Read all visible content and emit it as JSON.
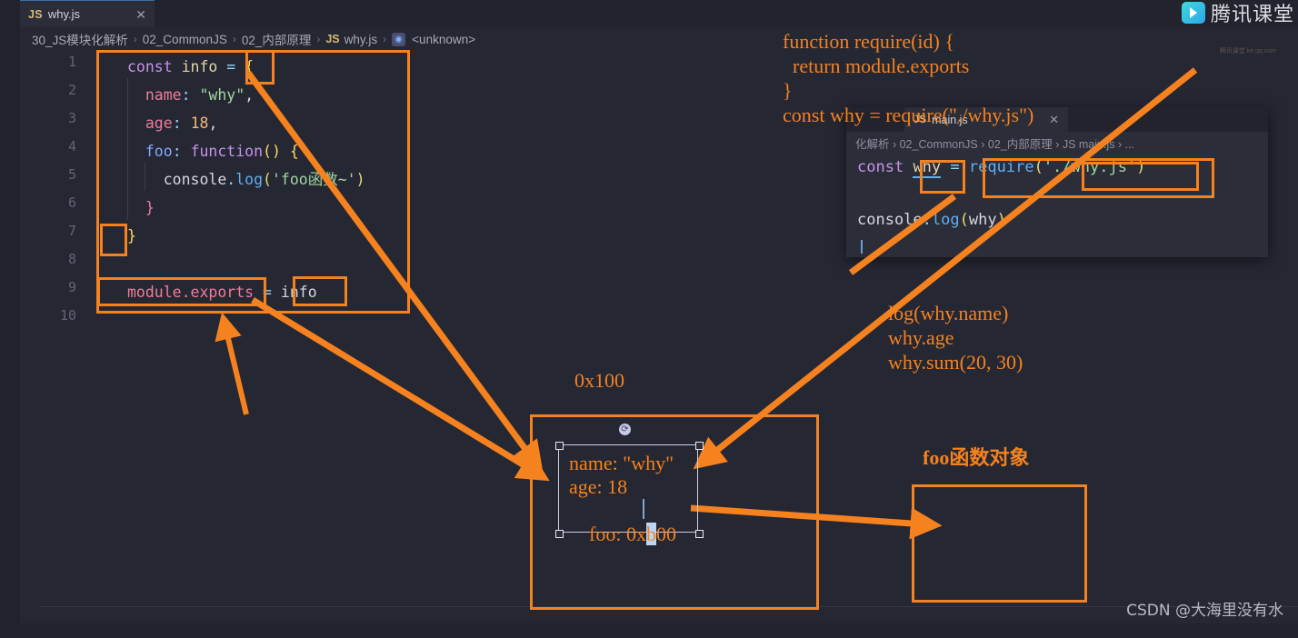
{
  "window": {
    "tab": {
      "badge": "JS",
      "title": "why.js",
      "close": "✕"
    },
    "breadcrumb": {
      "items": [
        "30_JS模块化解析",
        "02_CommonJS",
        "02_内部原理",
        "why.js",
        "<unknown>"
      ],
      "js_badge": "JS",
      "symbol_icon": "◉",
      "separator": "›"
    }
  },
  "editor": {
    "line_numbers": [
      "1",
      "2",
      "3",
      "4",
      "5",
      "6",
      "7",
      "8",
      "9",
      "10"
    ],
    "lines": [
      "const info = {",
      "  name: \"why\",",
      "  age: 18,",
      "  foo: function() {",
      "    console.log('foo函数~')",
      "  }",
      "}",
      "",
      "module.exports = info",
      ""
    ]
  },
  "float_panel": {
    "tab": {
      "badge": "JS",
      "title": "main.js",
      "close": "✕"
    },
    "breadcrumb": "化解析 › 02_CommonJS › 02_内部原理 › JS main.js › ...",
    "js_badge": "JS",
    "lines": [
      "const why = require('./why.js')",
      "console.log(why)"
    ]
  },
  "annotations": {
    "require_note": "function require(id) {\n  return module.exports\n}\nconst why = require(\"./why.js\")",
    "usage_note": "log(why.name)\nwhy.age\nwhy.sum(20, 30)",
    "address_label": "0x100",
    "foo_object_label": "foo函数对象",
    "object_text": {
      "line1": "name: \"why\"",
      "line2": "age: 18",
      "line3_pre": "foo: 0x",
      "line3_sel": "b",
      "line3_post": "00"
    },
    "rotate_handle_icon": "⟳",
    "accent_color": "#f5821f",
    "selection_highlight_color": "#b9d6f5"
  },
  "watermarks": {
    "tencent": "腾讯课堂",
    "tencent_sub": "腾讯课堂\nke.qq.com",
    "csdn": "CSDN @大海里没有水"
  }
}
